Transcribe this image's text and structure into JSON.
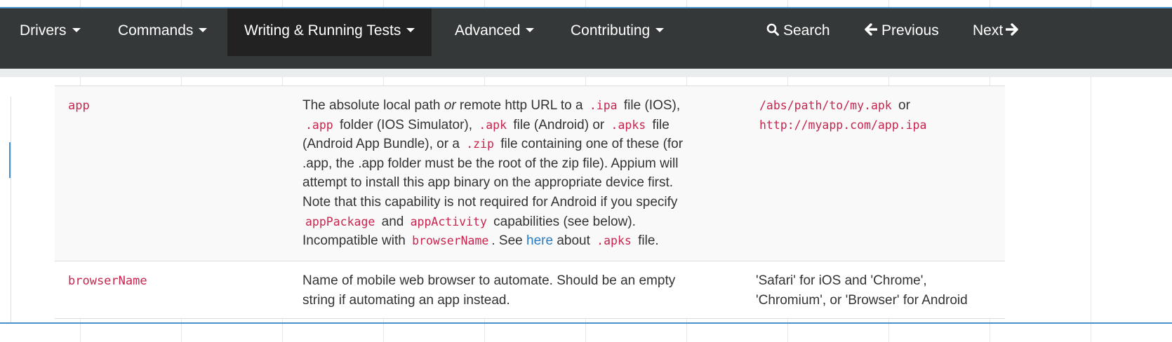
{
  "nav": {
    "items": [
      {
        "label": "Drivers"
      },
      {
        "label": "Commands"
      },
      {
        "label": "Writing & Running Tests"
      },
      {
        "label": "Advanced"
      },
      {
        "label": "Contributing"
      }
    ],
    "search_label": "Search",
    "previous_label": "Previous",
    "next_label": "Next"
  },
  "table": {
    "rows": [
      {
        "name": "app",
        "desc": {
          "l1a": "The absolute local path ",
          "l1em": "or",
          "l1b": " remote http URL to a ",
          "l1code": ".ipa",
          "l1c": " file (IOS),",
          "l2code1": ".app",
          "l2a": " folder (IOS Simulator), ",
          "l2code2": ".apk",
          "l2b": " file (Android) or ",
          "l2code3": ".apks",
          "l2c": " file",
          "l3a": "(Android App Bundle), or a ",
          "l3code": ".zip",
          "l3b": " file containing one of these (for",
          "l4": ".app, the .app folder must be the root of the zip file). Appium will",
          "l5": "attempt to install this app binary on the appropriate device first.",
          "l6": "Note that this capability is not required for Android if you specify",
          "l7code1": "appPackage",
          "l7a": " and ",
          "l7code2": "appActivity",
          "l7b": " capabilities (see below).",
          "l8a": "Incompatible with ",
          "l8code": "browserName",
          "l8b": ". See ",
          "l8link": "here",
          "l8c": " about ",
          "l8code2": ".apks",
          "l8d": " file."
        },
        "example": {
          "code1": "/abs/path/to/my.apk",
          "or": " or",
          "code2": "http://myapp.com/app.ipa"
        }
      },
      {
        "name": "browserName",
        "desc": {
          "l1": "Name of mobile web browser to automate. Should be an empty",
          "l2": "string if automating an app instead."
        },
        "example": {
          "l1": "'Safari' for iOS and 'Chrome',",
          "l2": "'Chromium', or 'Browser' for Android"
        }
      }
    ]
  },
  "colors": {
    "navbar_bg": "#343838",
    "navbar_active_bg": "#222222",
    "code_color": "#c7254e",
    "link_color": "#2a7bbf",
    "accent_line": "#4a90c9"
  }
}
